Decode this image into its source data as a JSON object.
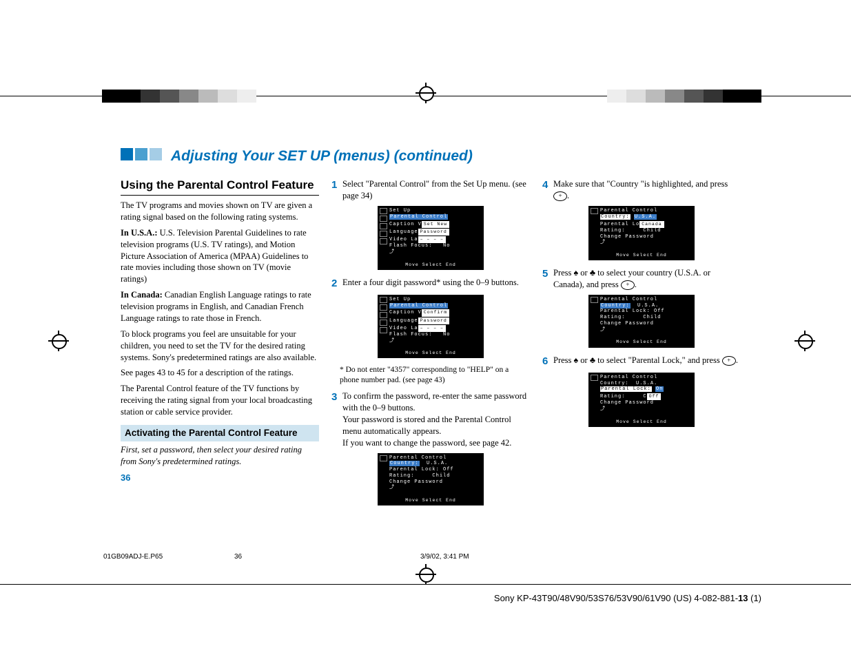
{
  "header": {
    "title": "Adjusting Your SET UP (menus) (continued)"
  },
  "col1": {
    "h2": "Using the Parental Control Feature",
    "p1": "The TV programs and movies shown on TV are given a rating signal based on the following rating systems.",
    "usa_b": "In U.S.A.:",
    "usa": "  U.S. Television Parental Guidelines to rate television programs (U.S. TV ratings), and Motion Picture Association of America (MPAA) Guidelines to rate movies including those shown on TV (movie ratings)",
    "can_b": "In Canada:",
    "can": "  Canadian English Language ratings to rate television programs in English, and Canadian French Language ratings to rate those in French.",
    "p2": "To block programs you feel are unsuitable for your children, you need to set the TV for the desired rating systems. Sony's predetermined ratings are also available.",
    "p3": "See pages 43 to 45 for a description of the ratings.",
    "p4": "The Parental Control feature of the TV functions by receiving the rating signal from your local broadcasting station or cable service provider.",
    "h3": "Activating the Parental Control Feature",
    "em": "First, set a password, then select your desired rating from Sony's predetermined ratings.",
    "pnum": "36"
  },
  "col2": {
    "s1n": "1",
    "s1": "Select \"Parental Control\" from the Set Up menu. (see page 34)",
    "scr1": {
      "t": "Set Up",
      "r1": "Parental Control",
      "r2": "Caption V",
      "r2b": "Set New",
      "r3": "Language",
      "r3b": "Password",
      "r4": "Video La",
      "r4b": "– – – –",
      "r5": "Flash Focus:",
      "r5v": "No",
      "ft": "Move    Select    End"
    },
    "s2n": "2",
    "s2": "Enter a four digit password* using the 0–9 buttons.",
    "scr2": {
      "t": "Set Up",
      "r1": "Parental Control",
      "r2": "Caption V",
      "r2b": "Confirm",
      "r3": "Language",
      "r3b": "Password",
      "r4": "Video La",
      "r4b": "– – – –",
      "r5": "Flash Focus:",
      "r5v": "No",
      "ft": "Move    Select    End"
    },
    "note": "* Do not enter \"4357\" corresponding to \"HELP\" on a phone number pad. (see page 43)",
    "s3n": "3",
    "s3a": "To confirm the password, re-enter the same password with the 0–9 buttons.",
    "s3b": "Your password is stored and the Parental Control menu automatically appears.",
    "s3c": "If you want to change the password, see page 42.",
    "scr3": {
      "t": "Parental Control",
      "r1": "Country:",
      "r1v": "U.S.A.",
      "r2": "Parental Lock:",
      "r2v": "Off",
      "r3": "Rating:",
      "r3v": "Child",
      "r4": "Change Password",
      "ft": "Move    Select    End"
    }
  },
  "col3": {
    "s4n": "4",
    "s4": "Make sure that \"Country \"is highlighted, and press ",
    "scr4": {
      "t": "Parental Control",
      "r1": "Country:",
      "r1v": "U.S.A.",
      "r2": "Parental Lo",
      "r2b": "Canada",
      "r3": "Rating:",
      "r3v": "Child",
      "r4": "Change Password",
      "ft": "Move    Select    End"
    },
    "s5n": "5",
    "s5a": "Press ",
    "s5b": " or ",
    "s5c": " to select your country (U.S.A. or Canada), and press ",
    "scr5": {
      "t": "Parental Control",
      "r1": "Country:",
      "r1v": "U.S.A.",
      "r2": "Parental Lock:",
      "r2v": "Off",
      "r3": "Rating:",
      "r3v": "Child",
      "r4": "Change Password",
      "ft": "Move    Select    End"
    },
    "s6n": "6",
    "s6a": "Press ",
    "s6b": " or ",
    "s6c": " to select \"Parental Lock,\" and press ",
    "scr6": {
      "t": "Parental Control",
      "r1": "Country:",
      "r1v": "U.S.A.",
      "r2": "Parental Lock:",
      "r2b": "On",
      "r3": "Rating:",
      "r3v": "C",
      "r3b": "Off",
      "r4": "Change Password",
      "ft": "Move    Select    End"
    }
  },
  "printfoot": {
    "file": "01GB09ADJ-E.P65",
    "pg": "36",
    "dt": "3/9/02, 3:41 PM"
  },
  "model": {
    "a": "Sony KP-43T90/48V90/53S76/53V90/61V90 (US) 4-082-881-",
    "b": "13",
    "c": " (1)"
  }
}
